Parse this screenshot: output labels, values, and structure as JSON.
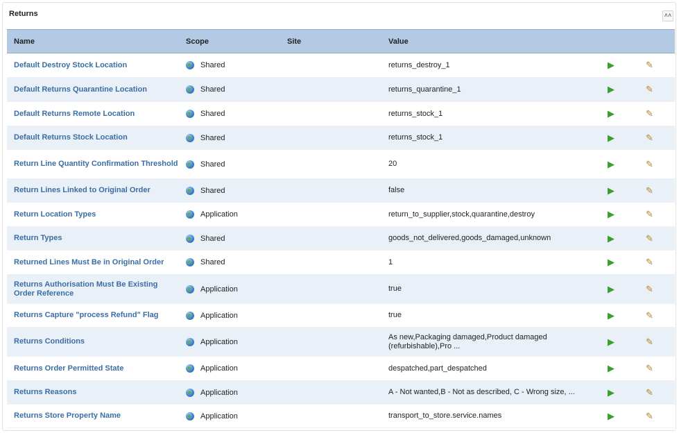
{
  "panel": {
    "title": "Returns",
    "collapse_symbol": "˄˄"
  },
  "table": {
    "headers": {
      "name": "Name",
      "scope": "Scope",
      "site": "Site",
      "value": "Value"
    },
    "rows": [
      {
        "name": "Default Destroy Stock Location",
        "scope": "Shared",
        "site": "",
        "value": "returns_destroy_1"
      },
      {
        "name": "Default Returns Quarantine Location",
        "scope": "Shared",
        "site": "",
        "value": "returns_quarantine_1"
      },
      {
        "name": "Default Returns Remote Location",
        "scope": "Shared",
        "site": "",
        "value": "returns_stock_1"
      },
      {
        "name": "Default Returns Stock Location",
        "scope": "Shared",
        "site": "",
        "value": "returns_stock_1"
      },
      {
        "name": "Return Line Quantity Confirmation Threshold",
        "scope": "Shared",
        "site": "",
        "value": "20"
      },
      {
        "name": "Return Lines Linked to Original Order",
        "scope": "Shared",
        "site": "",
        "value": "false"
      },
      {
        "name": "Return Location Types",
        "scope": "Application",
        "site": "",
        "value": "return_to_supplier,stock,quarantine,destroy"
      },
      {
        "name": "Return Types",
        "scope": "Shared",
        "site": "",
        "value": "goods_not_delivered,goods_damaged,unknown"
      },
      {
        "name": "Returned Lines Must Be in Original Order",
        "scope": "Shared",
        "site": "",
        "value": "1"
      },
      {
        "name": "Returns Authorisation Must Be Existing Order Reference",
        "scope": "Application",
        "site": "",
        "value": "true"
      },
      {
        "name": "Returns Capture \"process Refund\" Flag",
        "scope": "Application",
        "site": "",
        "value": "true"
      },
      {
        "name": "Returns Conditions",
        "scope": "Application",
        "site": "",
        "value": "As new,Packaging damaged,Product damaged (refurbishable),Pro ..."
      },
      {
        "name": "Returns Order Permitted State",
        "scope": "Application",
        "site": "",
        "value": "despatched,part_despatched"
      },
      {
        "name": "Returns Reasons",
        "scope": "Application",
        "site": "",
        "value": "A - Not wanted,B - Not as described, C - Wrong size, ..."
      },
      {
        "name": "Returns Store Property Name",
        "scope": "Application",
        "site": "",
        "value": "transport_to_store.service.names"
      }
    ]
  },
  "icons": {
    "scope": "globe-icon",
    "execute": "play-icon",
    "edit": "pencil-icon",
    "execute_glyph": "▶",
    "edit_glyph": "✎"
  },
  "colors": {
    "header_bg": "#b4cae4",
    "link": "#3a6ea5",
    "row_alt": "#e9f0f8"
  }
}
